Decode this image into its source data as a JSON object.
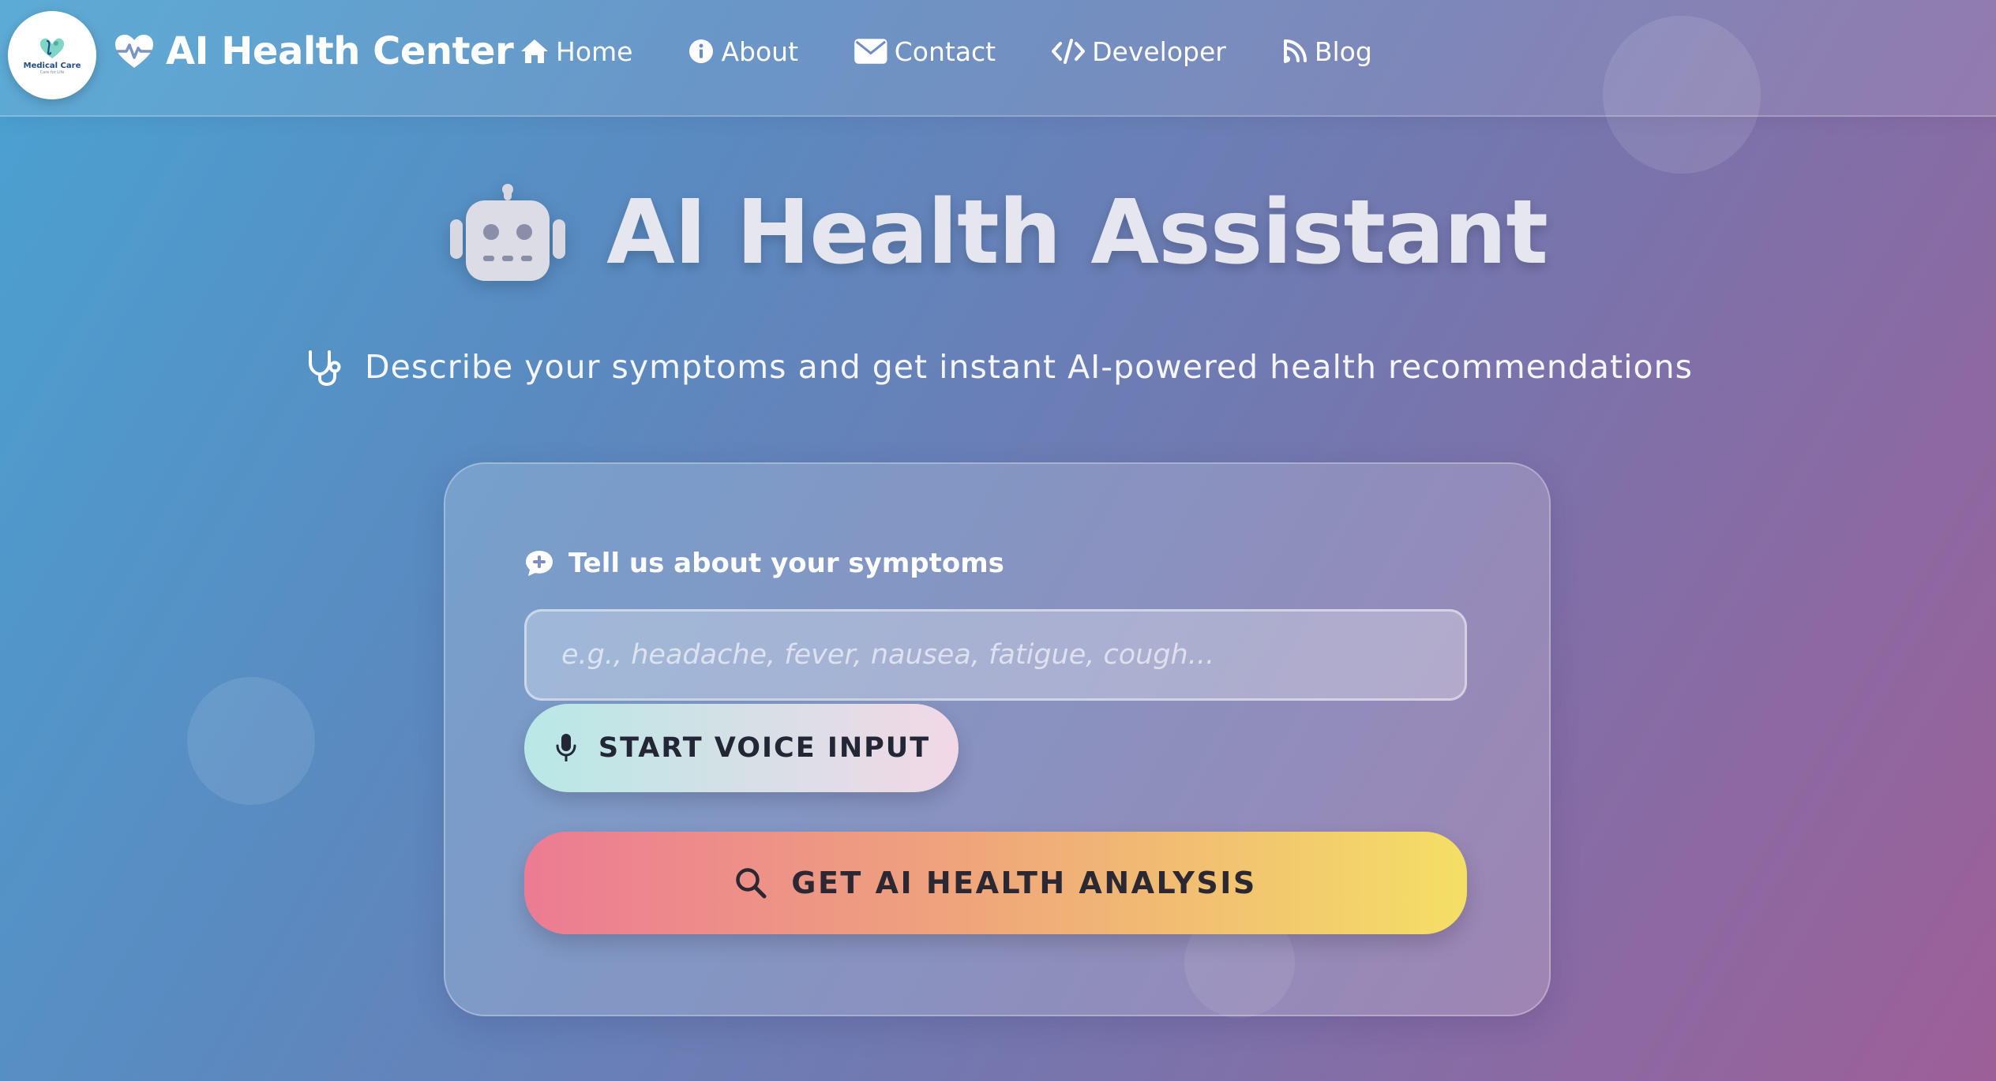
{
  "navbar": {
    "logo": {
      "text": "Medical Care",
      "sub": "Care for Life"
    },
    "brand_title": "AI Health Center",
    "items": [
      {
        "label": "Home",
        "icon": "home-icon"
      },
      {
        "label": "About",
        "icon": "info-icon"
      },
      {
        "label": "Contact",
        "icon": "envelope-icon"
      },
      {
        "label": "Developer",
        "icon": "code-icon"
      },
      {
        "label": "Blog",
        "icon": "feed-icon"
      }
    ]
  },
  "hero": {
    "icon": "robot-icon",
    "title": "AI Health Assistant",
    "subtitle_icon": "stethoscope-icon",
    "subtitle": "Describe your symptoms and get instant AI-powered health recommendations"
  },
  "form": {
    "label_icon": "comment-medical-icon",
    "label": "Tell us about your symptoms",
    "input_value": "",
    "input_placeholder": "e.g., headache, fever, nausea, fatigue, cough...",
    "voice_button": {
      "label": "START VOICE INPUT",
      "icon": "microphone-icon"
    },
    "analyze_button": {
      "label": "GET AI HEALTH ANALYSIS",
      "icon": "search-icon"
    }
  },
  "colors": {
    "background_start": "#4aa2d2",
    "background_end": "#9d5f98",
    "voice_gradient": [
      "#b8e8e6",
      "#f2d8e6"
    ],
    "analyze_gradient": [
      "#ec7b94",
      "#efa67b",
      "#f4df66"
    ]
  }
}
